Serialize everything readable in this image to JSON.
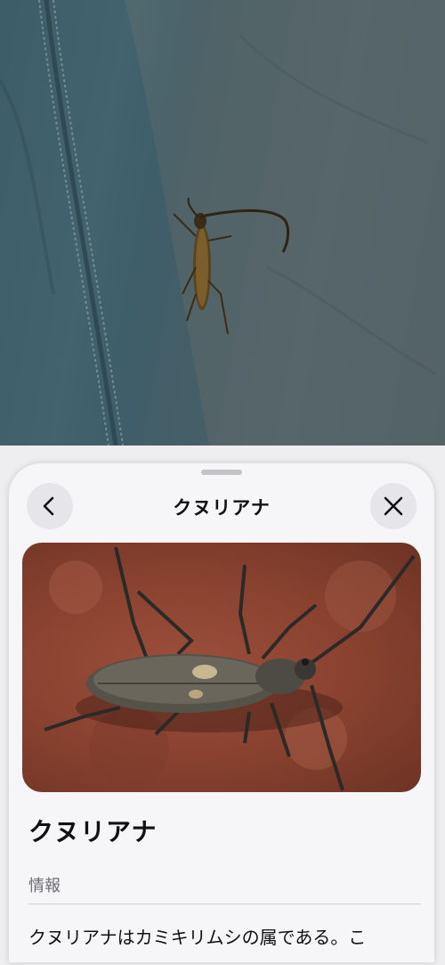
{
  "sheet": {
    "title": "クヌリアナ",
    "back_icon": "chevron-left-icon",
    "close_icon": "close-icon"
  },
  "species": {
    "name": "クヌリアナ",
    "section_label": "情報",
    "description": "クヌリアナはカミキリムシの属である。こ"
  }
}
